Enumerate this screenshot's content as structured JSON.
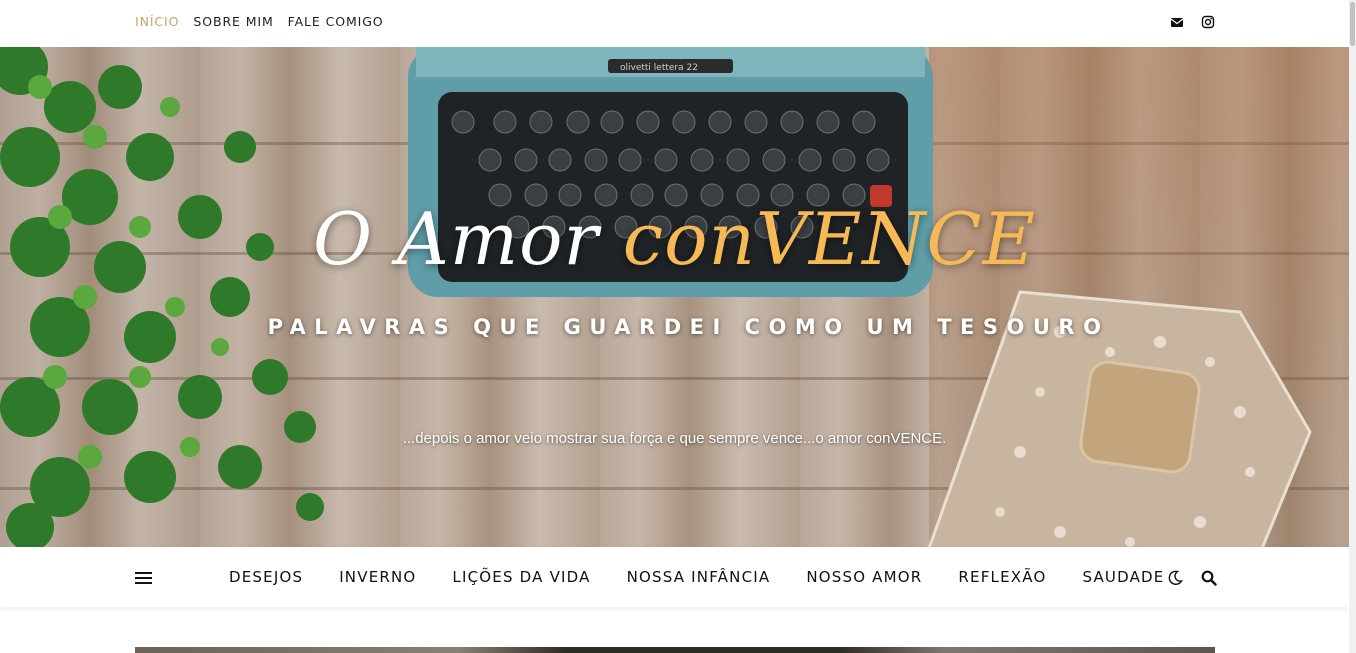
{
  "topbar": {
    "nav": [
      {
        "label": "INÍCIO",
        "active": true
      },
      {
        "label": "SOBRE MIM",
        "active": false
      },
      {
        "label": "FALE COMIGO",
        "active": false
      }
    ],
    "social_icons": [
      "envelope-icon",
      "instagram-icon"
    ]
  },
  "hero": {
    "title_main": "O Amor ",
    "title_accent": "conVENCE",
    "subtitle": "PALAVRAS QUE GUARDEI COMO UM TESOURO",
    "description": "...depois o amor veio mostrar sua força e que sempre vence...o amor conVENCE.",
    "typewriter_brand": "olivetti lettera 22"
  },
  "mainnav": {
    "items": [
      "DESEJOS",
      "INVERNO",
      "LIÇÕES DA VIDA",
      "NOSSA INFÂNCIA",
      "NOSSO AMOR",
      "REFLEXÃO",
      "SAUDADE"
    ],
    "icons": [
      "menu-icon",
      "moon-icon",
      "search-icon"
    ]
  },
  "colors": {
    "accent": "#c8a46b",
    "title_accent": "#f7b956",
    "text": "#111111"
  }
}
